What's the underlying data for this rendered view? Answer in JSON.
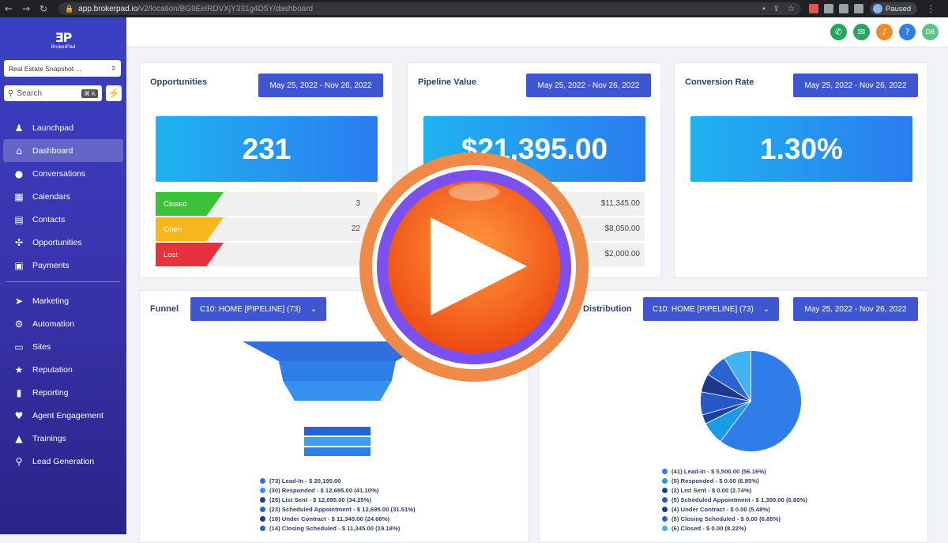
{
  "browser": {
    "url_host": "app.brokerpad.io",
    "url_path": "/v2/location/BG9EelRDVXjY331g4D5Y/dashboard",
    "profile_label": "Paused"
  },
  "sidebar": {
    "logo_text": "BrokerPad",
    "account_select": "Real Estate Snapshot ...",
    "search_placeholder": "Search",
    "search_shortcut": "⌘ K",
    "items_top": [
      {
        "label": "Launchpad",
        "icon": "rocket-icon"
      },
      {
        "label": "Dashboard",
        "icon": "home-icon",
        "active": true
      },
      {
        "label": "Conversations",
        "icon": "chat-icon"
      },
      {
        "label": "Calendars",
        "icon": "calendar-icon"
      },
      {
        "label": "Contacts",
        "icon": "contacts-icon"
      },
      {
        "label": "Opportunities",
        "icon": "opportunities-icon"
      },
      {
        "label": "Payments",
        "icon": "payments-icon"
      }
    ],
    "items_bottom": [
      {
        "label": "Marketing",
        "icon": "send-icon"
      },
      {
        "label": "Automation",
        "icon": "automation-icon"
      },
      {
        "label": "Sites",
        "icon": "sites-icon"
      },
      {
        "label": "Reputation",
        "icon": "reputation-icon"
      },
      {
        "label": "Reporting",
        "icon": "reporting-icon"
      },
      {
        "label": "Agent Engagement",
        "icon": "heart-icon"
      },
      {
        "label": "Trainings",
        "icon": "graduation-icon"
      },
      {
        "label": "Lead Generation",
        "icon": "search-icon"
      }
    ]
  },
  "cards": {
    "opportunities": {
      "title": "Opportunities",
      "date_range": "May 25, 2022 - Nov 26, 2022",
      "value": "231",
      "rows": [
        {
          "label": "Closed",
          "value": "3",
          "color": "#3cc23a"
        },
        {
          "label": "Open",
          "value": "22",
          "color": "#f7b71c"
        },
        {
          "label": "Lost",
          "value": "",
          "color": "#e8313c"
        }
      ]
    },
    "pipeline_value": {
      "title": "Pipeline Value",
      "date_range": "May 25, 2022 - Nov 26, 2022",
      "value": "$21,395.00",
      "rows": [
        "$11,345.00",
        "$8,050.00",
        "$2,000.00"
      ]
    },
    "conversion_rate": {
      "title": "Conversion Rate",
      "date_range": "May 25, 2022 - Nov 26, 2022",
      "value": "1.30%"
    },
    "funnel": {
      "title": "Funnel",
      "pipeline_select": "C10: HOME [PIPELINE] (73)",
      "legend": [
        "(73) Lead-In - $ 20,195.00",
        "(30) Responded - $ 12,695.00 (41.10%)",
        "(25) List Sent - $ 12,695.00 (34.25%)",
        "(23) Scheduled Appointment - $ 12,695.00 (31.51%)",
        "(18) Under Contract - $ 11,345.00 (24.66%)",
        "(14) Closing Scheduled - $ 11,345.00 (19.18%)"
      ]
    },
    "distribution": {
      "title": "Distribution",
      "pipeline_select": "C10: HOME [PIPELINE] (73)",
      "date_range": "May 25, 2022 - Nov 26, 2022",
      "legend": [
        "(41) Lead-In - $ 5,500.00 (56.16%)",
        "(5) Responded - $ 0.00 (6.85%)",
        "(2) List Sent - $ 0.00 (2.74%)",
        "(5) Scheduled Appointment - $ 1,350.00 (6.85%)",
        "(4) Under Contract - $ 0.00 (5.48%)",
        "(5) Closing Scheduled - $ 0.00 (6.85%)",
        "(6) Closed - $ 0.00 (8.22%)"
      ]
    }
  },
  "chart_data": [
    {
      "type": "funnel",
      "categories": [
        "Lead-In",
        "Responded",
        "List Sent",
        "Scheduled Appointment",
        "Under Contract",
        "Closing Scheduled"
      ],
      "values": [
        73,
        30,
        25,
        23,
        18,
        14
      ]
    },
    {
      "type": "pie",
      "categories": [
        "Lead-In",
        "Responded",
        "List Sent",
        "Scheduled Appointment",
        "Under Contract",
        "Closing Scheduled",
        "Closed"
      ],
      "values": [
        56.16,
        6.85,
        2.74,
        6.85,
        5.48,
        6.85,
        8.22
      ],
      "colors": [
        "#2f7de8",
        "#1a9be6",
        "#1d3f9e",
        "#2658c9",
        "#1b3a8f",
        "#2b63d4",
        "#3fb4f2"
      ]
    }
  ],
  "colors": {
    "accent": "#3f56d3",
    "play_outer": "#f08a48",
    "play_ring": "#7b4ff0",
    "play_center": "#f2641e"
  }
}
